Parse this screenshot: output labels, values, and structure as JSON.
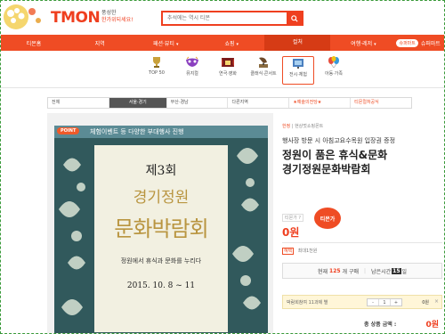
{
  "header": {
    "logo": "TMON",
    "tagline_line1": "풍성한",
    "tagline_line2": "한가위되세요!",
    "search_placeholder": "추석에는 역시 티몬"
  },
  "nav": {
    "items": [
      {
        "label": "티몬홈",
        "caret": ""
      },
      {
        "label": "지역",
        "caret": ""
      },
      {
        "label": "패션·뷰티",
        "caret": "▾"
      },
      {
        "label": "쇼핑",
        "caret": "▾"
      },
      {
        "label": "컬처",
        "caret": ""
      },
      {
        "label": "여행·레저",
        "caret": "▾"
      }
    ],
    "ship_badge": "슈퍼마트",
    "extra_label": "슈퍼마트"
  },
  "categories": [
    {
      "label": "TOP 50",
      "icon": "trophy-icon"
    },
    {
      "label": "뮤지컬",
      "icon": "mask-icon"
    },
    {
      "label": "연극·영화",
      "icon": "theater-icon"
    },
    {
      "label": "클래식·콘서트",
      "icon": "gramophone-icon"
    },
    {
      "label": "전시·체험",
      "icon": "exhibition-icon"
    },
    {
      "label": "아동·가족",
      "icon": "balloon-icon"
    }
  ],
  "subtabs": [
    {
      "label": "전체"
    },
    {
      "label": "서울·경기"
    },
    {
      "label": "부산·경남"
    },
    {
      "label": "다른지역"
    },
    {
      "label": "★예술의전당★"
    },
    {
      "label": "티몬컬처공식"
    }
  ],
  "poster": {
    "point_badge": "POINT",
    "point_text": "체험이벤트 등 다양한 부대행사 진행",
    "edition": "제3회",
    "title1": "경기정원",
    "title2": "문화박람회",
    "subtitle": "정원에서 휴식과 문화를 누리다",
    "date": "2015. 10. 8 ~ 11"
  },
  "deal": {
    "shop_brand": "한정",
    "shop_name": "| 현상멋쇼핑몬트",
    "subtitle": "행사장 방문 시 아침고요수목원 입장권 증정",
    "title_line1": "정원이 품은 휴식&문화",
    "title_line2": "경기정원문화박람회",
    "price_label": "티몬가 ?",
    "price": "0원",
    "buy_button": "티몬가",
    "benefit_tag": "혜택",
    "benefit_text": "최대1천원",
    "current_label": "현재",
    "current_count": "125",
    "current_suffix": "개 구매",
    "remaining_label": "남은시간",
    "remaining_digit": "15",
    "remaining_suffix": "일",
    "option_text": "박람회참여 11과제 별",
    "stepper_minus": "-",
    "stepper_value": "1",
    "stepper_plus": "+",
    "option_price": "0원",
    "option_close": "×",
    "total_label": "총 상품 금액 :",
    "total_price": "0원"
  }
}
